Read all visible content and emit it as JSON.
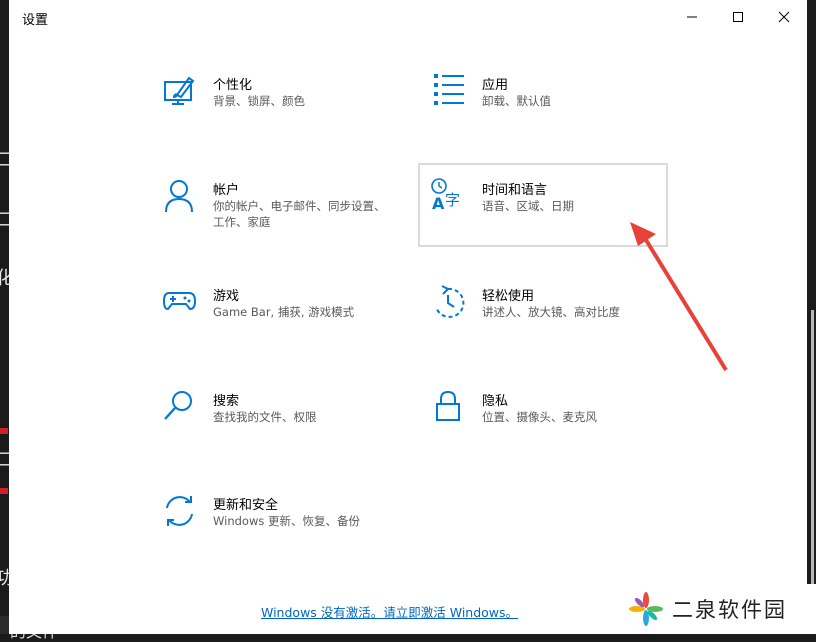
{
  "window": {
    "title": "设置"
  },
  "tiles": [
    {
      "name": "个性化",
      "desc": "背景、锁屏、颜色",
      "icon": "personalization-icon"
    },
    {
      "name": "应用",
      "desc": "卸载、默认值",
      "icon": "apps-icon"
    },
    {
      "name": "帐户",
      "desc": "你的帐户、电子邮件、同步设置、工作、家庭",
      "icon": "accounts-icon"
    },
    {
      "name": "时间和语言",
      "desc": "语音、区域、日期",
      "icon": "time-language-icon"
    },
    {
      "name": "游戏",
      "desc": "Game Bar, 捕获, 游戏模式",
      "icon": "gaming-icon"
    },
    {
      "name": "轻松使用",
      "desc": "讲述人、放大镜、高对比度",
      "icon": "ease-of-access-icon"
    },
    {
      "name": "搜索",
      "desc": "查找我的文件、权限",
      "icon": "search-icon"
    },
    {
      "name": "隐私",
      "desc": "位置、摄像头、麦克风",
      "icon": "privacy-lock-icon"
    },
    {
      "name": "更新和安全",
      "desc": "Windows 更新、恢复、备份",
      "icon": "update-security-icon"
    }
  ],
  "activation_link": "Windows 没有激活。请立即激活 Windows。",
  "watermark": {
    "text": "二泉软件园"
  },
  "background_fragments": [
    "口",
    "口",
    "化",
    "口",
    "功",
    "的文件"
  ],
  "colors": {
    "accent": "#0067c0",
    "icon": "#0078d4",
    "arrow": "#e8413a"
  }
}
